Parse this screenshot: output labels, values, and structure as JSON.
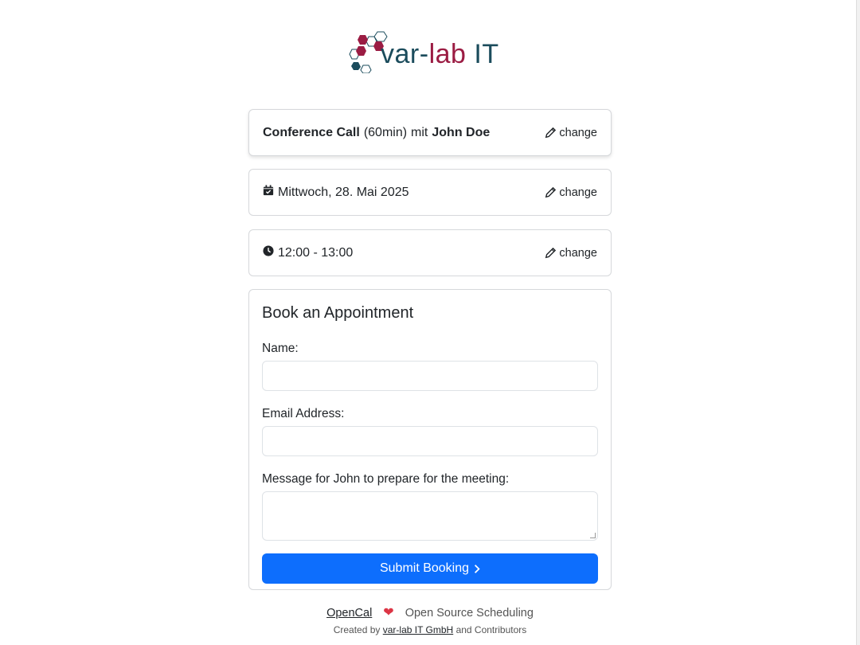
{
  "logo": {
    "text_a": "var-",
    "text_b": "lab",
    "text_c": " IT"
  },
  "event": {
    "title": "Conference Call",
    "duration": "(60min)",
    "with": "mit",
    "host": "John Doe",
    "change": "change"
  },
  "date": {
    "label": "Mittwoch, 28. Mai 2025",
    "change": "change"
  },
  "time": {
    "label": "12:00 - 13:00",
    "change": "change"
  },
  "form": {
    "heading": "Book an Appointment",
    "name_label": "Name:",
    "name_value": "",
    "email_label": "Email Address:",
    "email_value": "",
    "message_label": "Message for John to prepare for the meeting:",
    "message_value": "",
    "submit": "Submit Booking"
  },
  "footer": {
    "link": "OpenCal",
    "tagline": "Open Source Scheduling",
    "created_by": "Created by",
    "company": "var-lab IT GmbH",
    "contributors": "and Contributors"
  },
  "colors": {
    "primary": "#0d6efd",
    "heart": "#dc3545",
    "logo_teal": "#1b4c5c",
    "logo_red": "#9b1c43"
  }
}
